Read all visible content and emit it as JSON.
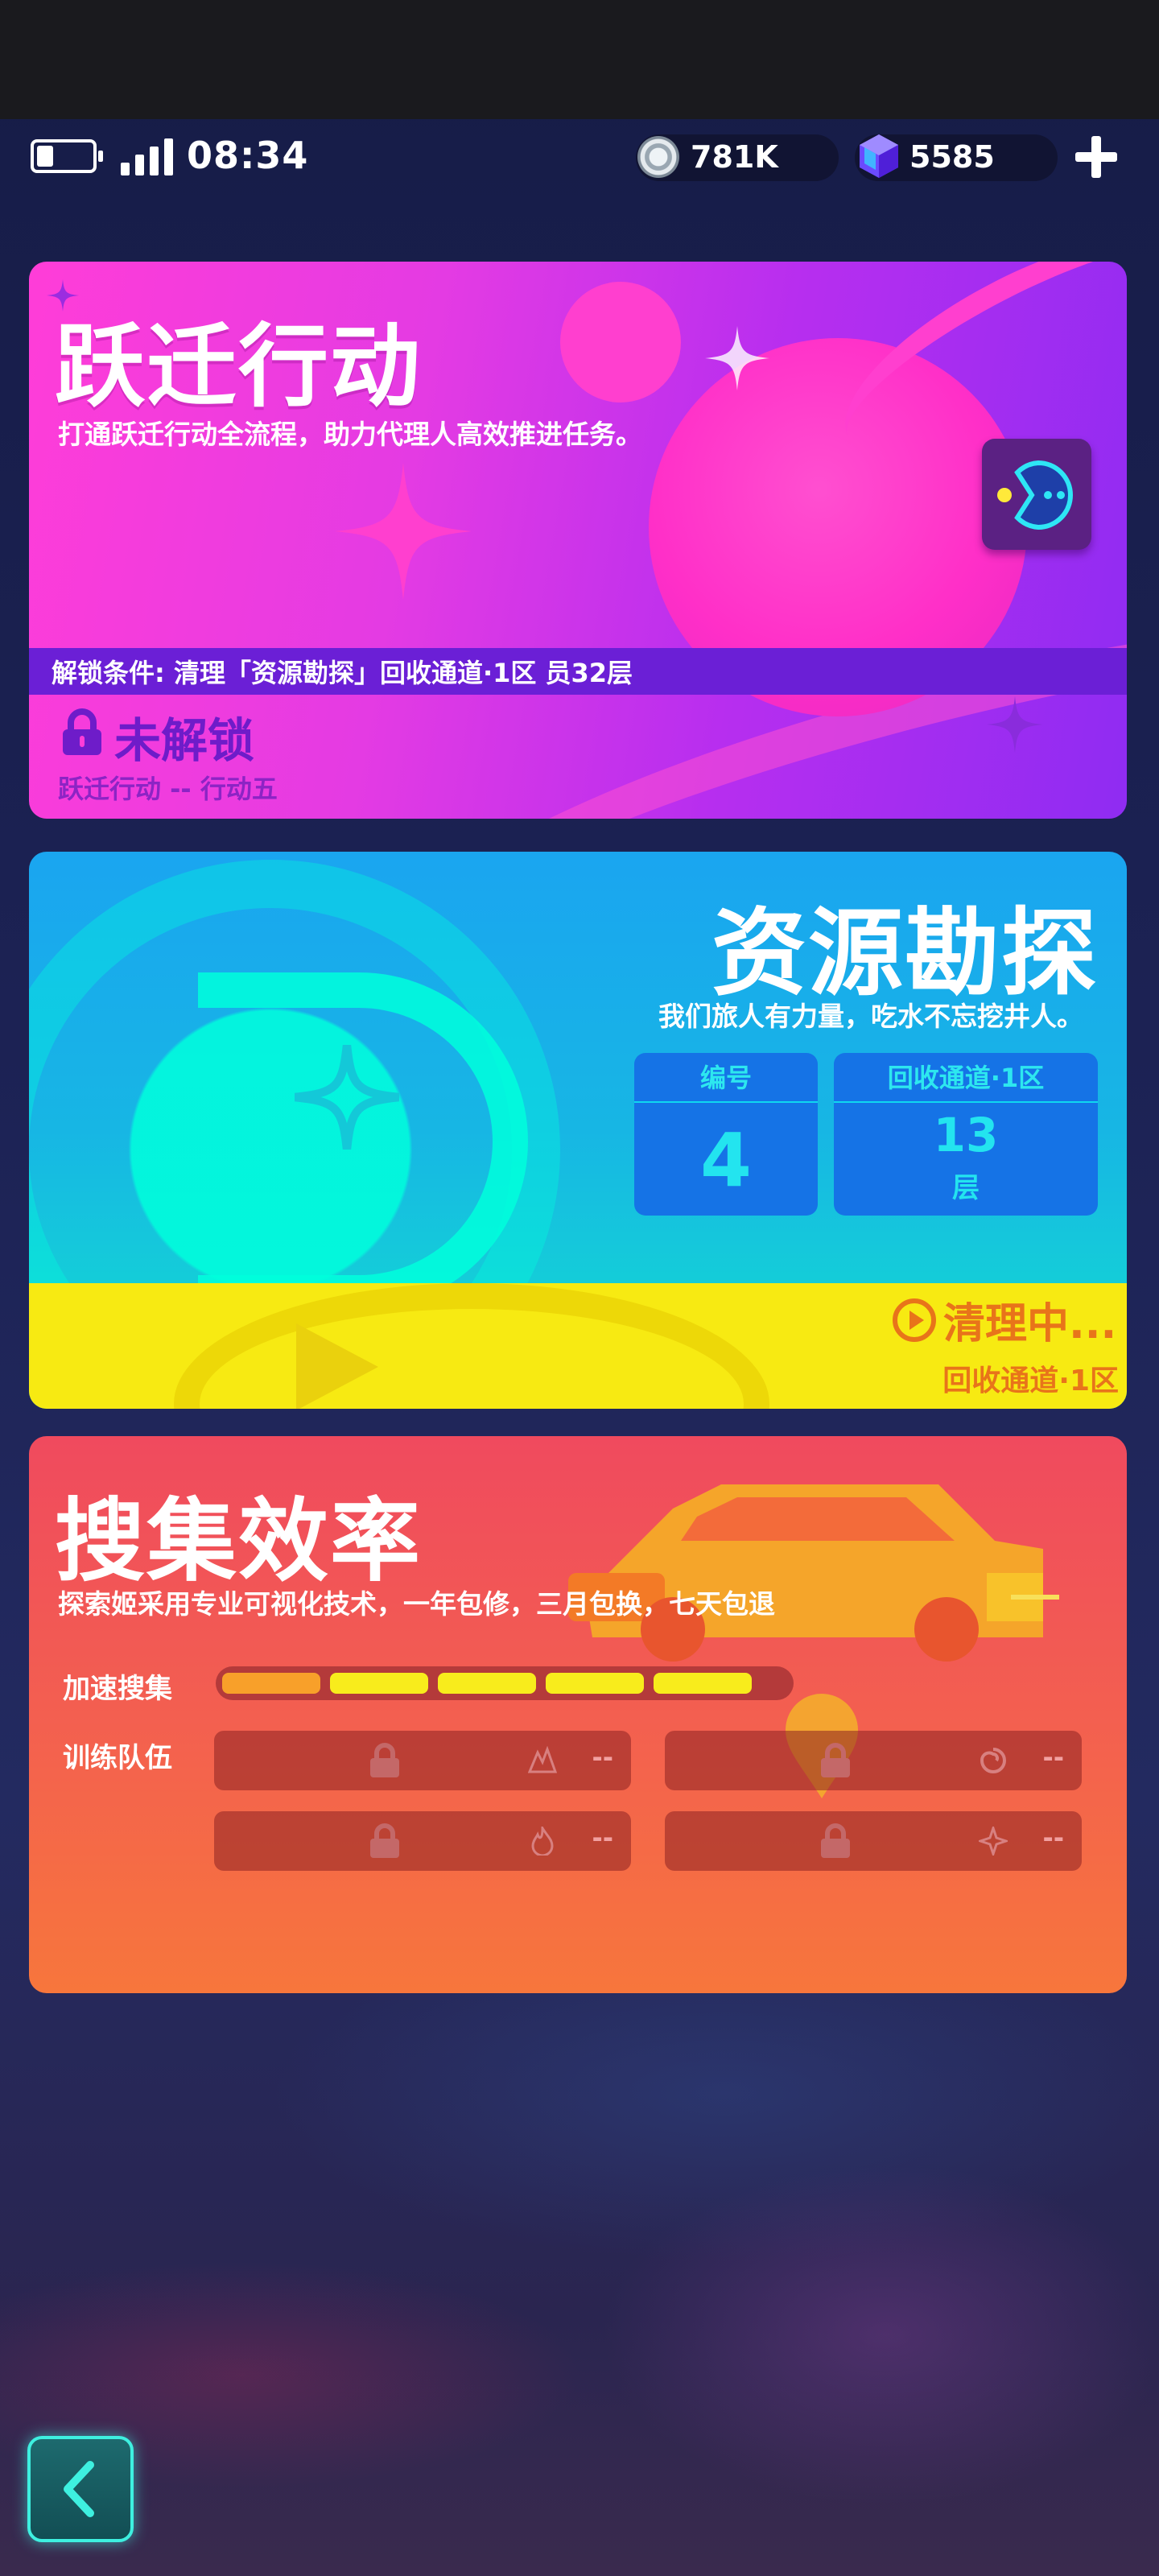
{
  "status_bar": {
    "time": "08:34",
    "coins": "781K",
    "gems": "5585"
  },
  "cards": [
    {
      "title": "跃迁行动",
      "subtitle": "打通跃迁行动全流程，助力代理人高效推进任务。",
      "unlock_condition": "解锁条件: 清理「资源勘探」回收通道·1区 员32层",
      "status": "未解锁",
      "footer": "跃迁行动 -- 行动五",
      "colors": {
        "bg": "#e43be3",
        "band": "#6b1fd6"
      }
    },
    {
      "title": "资源勘探",
      "subtitle": "我们旅人有力量，吃水不忘挖井人。",
      "number_label": "编号",
      "number_value": "4",
      "channel_label": "回收通道·1区",
      "floor_value": "13",
      "floor_unit": "层",
      "status": "清理中...",
      "footer": "回收通道·1区",
      "colors": {
        "bg": "#17b6e4",
        "band": "#f7ea12",
        "accent": "#e8741a"
      }
    },
    {
      "title": "搜集效率",
      "subtitle": "探索姬采用专业可视化技术，一年包修，三月包换，七天包退",
      "speed_label": "加速搜集",
      "speed_level": 5,
      "squad_label": "训练队伍",
      "slots": [
        {
          "icon": "flame-peak-icon",
          "value": "--"
        },
        {
          "icon": "swirl-icon",
          "value": "--"
        },
        {
          "icon": "fire-icon",
          "value": "--"
        },
        {
          "icon": "shuriken-icon",
          "value": "--"
        }
      ],
      "colors": {
        "bg": "#f35f50",
        "bar": "#f8ec1c"
      }
    }
  ]
}
